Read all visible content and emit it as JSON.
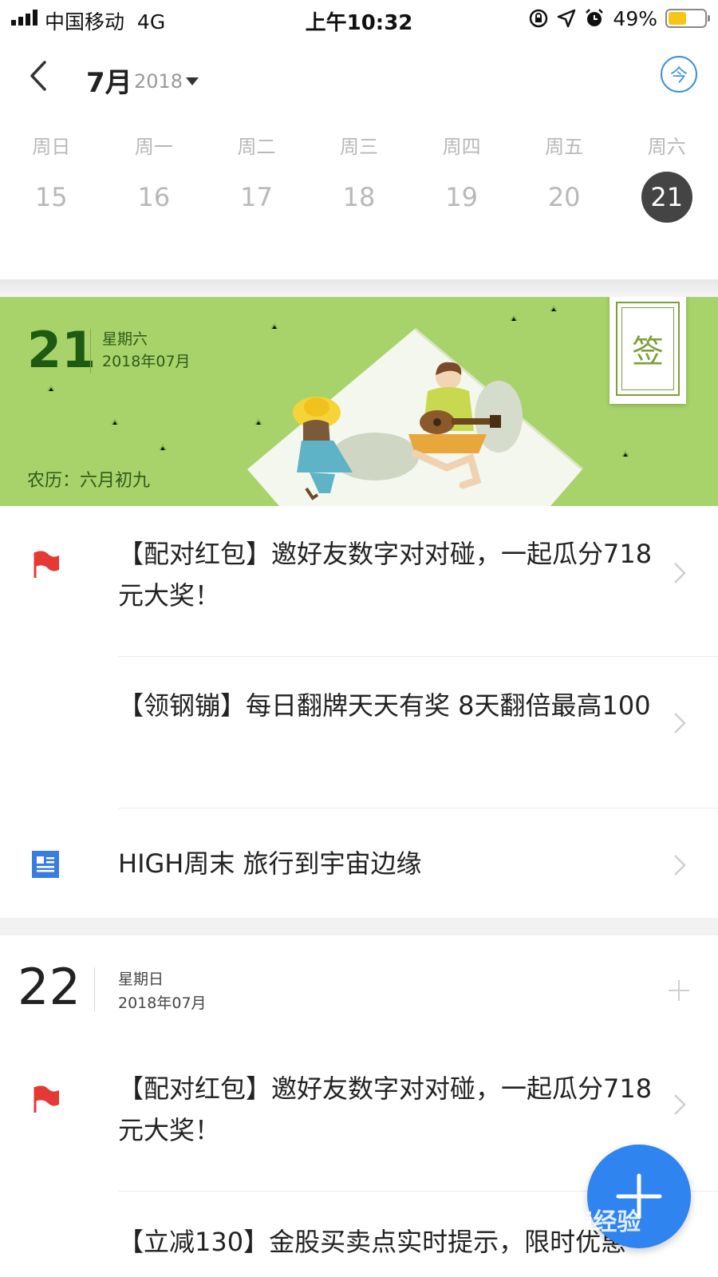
{
  "status_bar": {
    "carrier": "中国移动",
    "network": "4G",
    "time": "上午10:32",
    "battery": "49%",
    "battery_level": 0.49
  },
  "header": {
    "month": "7月",
    "year": "2018",
    "today_label": "今"
  },
  "week": {
    "days": [
      {
        "name": "周日",
        "num": "15"
      },
      {
        "name": "周一",
        "num": "16"
      },
      {
        "name": "周二",
        "num": "17"
      },
      {
        "name": "周三",
        "num": "18"
      },
      {
        "name": "周四",
        "num": "19"
      },
      {
        "name": "周五",
        "num": "20"
      },
      {
        "name": "周六",
        "num": "21"
      }
    ],
    "selected": "21"
  },
  "banner": {
    "day": "21",
    "weekday": "星期六",
    "date": "2018年07月",
    "lunar": "农历：六月初九",
    "sign_label": "签",
    "bg_color": "#a8d36a"
  },
  "day21_items": [
    {
      "icon": "flag-icon",
      "text": "【配对红包】邀好友数字对对碰，一起瓜分718元大奖！"
    },
    {
      "icon": "",
      "text": "【领钢镚】每日翻牌天天有奖 8天翻倍最高100"
    },
    {
      "icon": "document-icon",
      "text": "HIGH周末 旅行到宇宙边缘"
    }
  ],
  "day22": {
    "day": "22",
    "weekday": "星期日",
    "date": "2018年07月"
  },
  "day22_items": [
    {
      "icon": "flag-icon",
      "text": "【配对红包】邀好友数字对对碰，一起瓜分718元大奖！"
    },
    {
      "icon": "",
      "text": "【立减130】金股买卖点实时提示，限时优惠"
    }
  ],
  "watermark": "Bai经验",
  "colors": {
    "accent": "#2f84f0",
    "flag": "#e53935",
    "doc": "#3a7de0"
  }
}
